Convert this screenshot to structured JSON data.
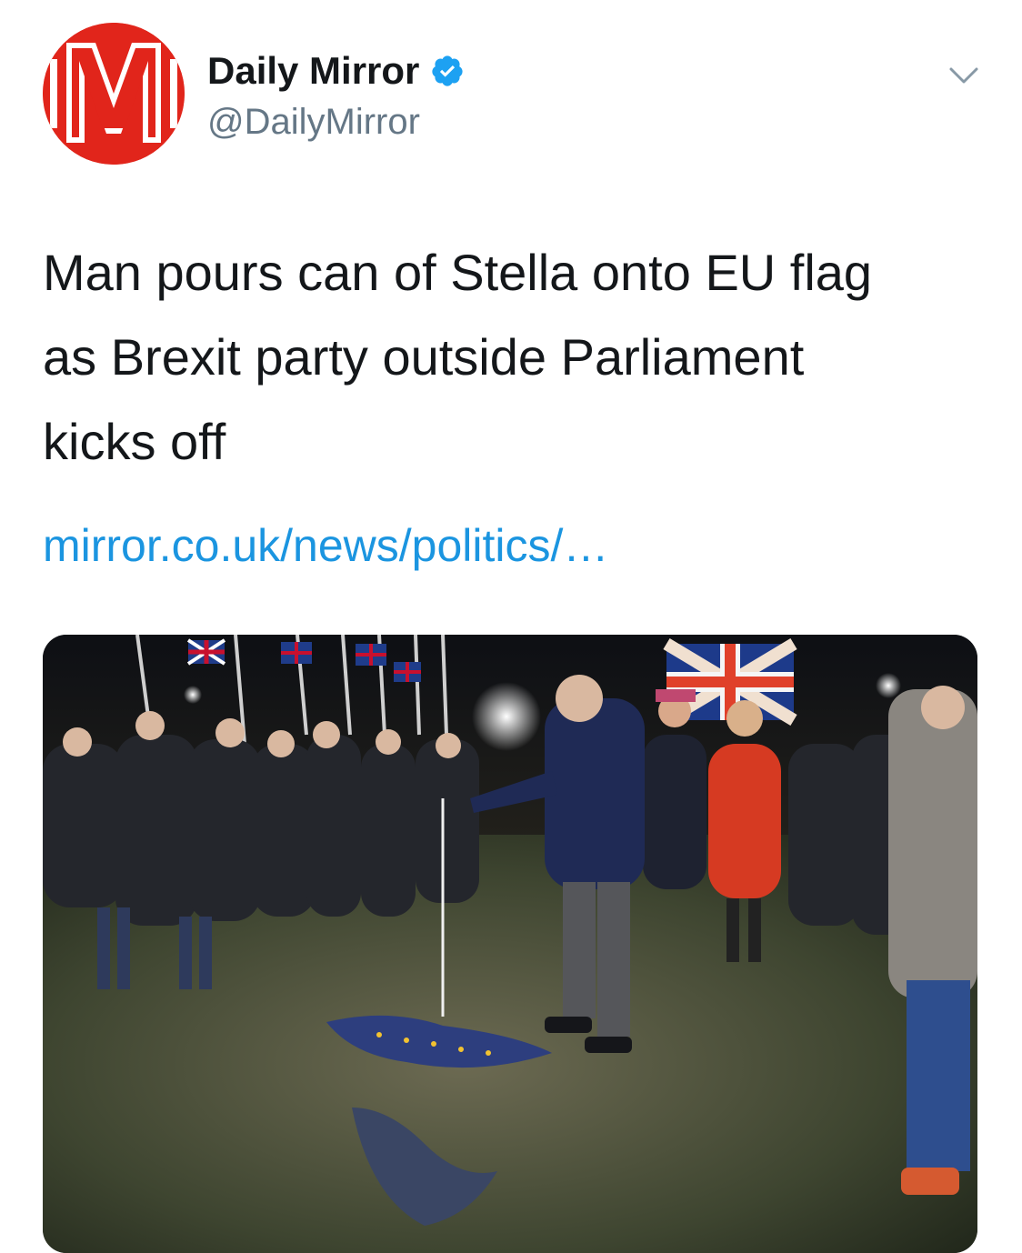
{
  "account": {
    "display_name": "Daily Mirror",
    "handle": "@DailyMirror",
    "verified": true,
    "avatar_letter": "M",
    "avatar_color": "#e1251b"
  },
  "tweet": {
    "text_lines": [
      "Man pours can of Stella onto EU flag",
      "as Brexit party outside Parliament",
      "kicks off"
    ],
    "link_text": "mirror.co.uk/news/politics/…"
  },
  "icons": {
    "verified": "verified-badge-icon",
    "menu": "chevron-down-icon"
  },
  "colors": {
    "link": "#1b95e0",
    "verified": "#1da1f2",
    "handle": "#657786",
    "text": "#14171a"
  }
}
